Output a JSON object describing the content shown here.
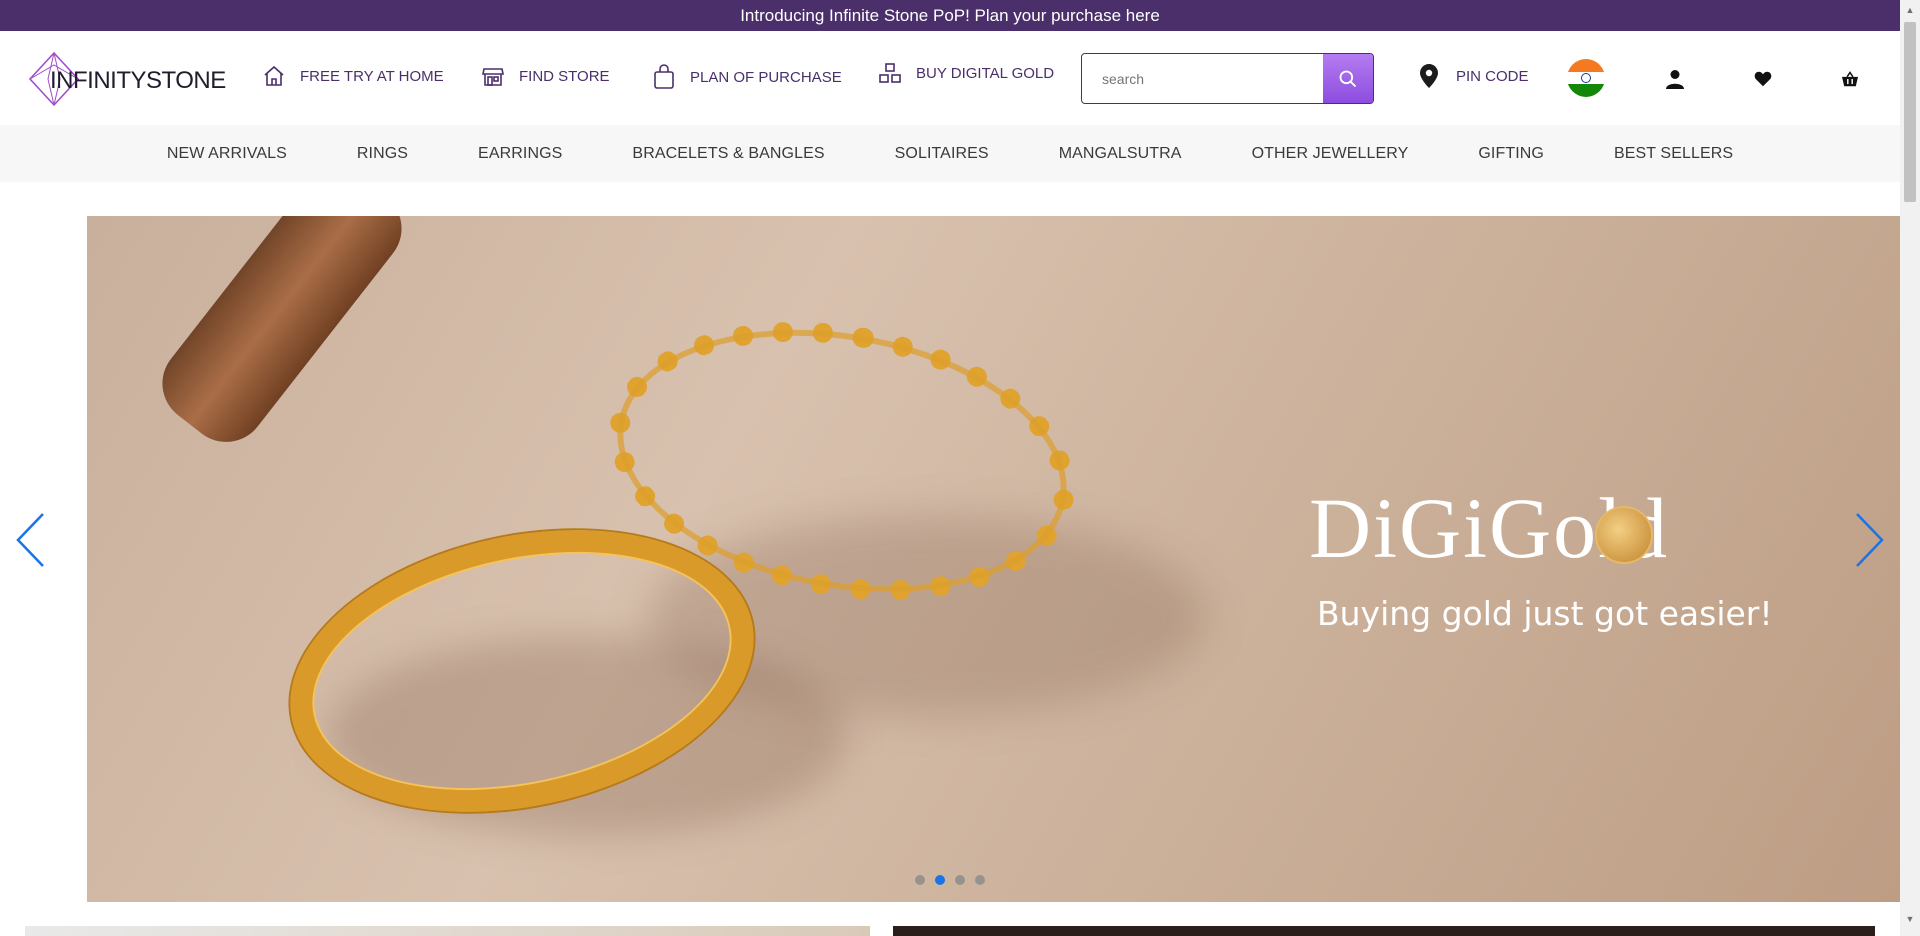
{
  "announcement": {
    "text": "Introducing Infinite Stone PoP! Plan your purchase here"
  },
  "header": {
    "logo_text": "INFINITYSTONE",
    "links": [
      {
        "label": "FREE TRY AT HOME",
        "icon": "home-icon"
      },
      {
        "label": "FIND STORE",
        "icon": "store-icon"
      },
      {
        "label": "PLAN OF PURCHASE",
        "icon": "shopping-bag-icon"
      },
      {
        "label": "BUY DIGITAL GOLD",
        "icon": "gold-bars-icon"
      }
    ],
    "search": {
      "placeholder": "search",
      "value": "search"
    },
    "pin_code": "PIN CODE",
    "country": "India"
  },
  "nav": {
    "items": [
      "NEW ARRIVALS",
      "RINGS",
      "EARRINGS",
      "BRACELETS & BANGLES",
      "SOLITAIRES",
      "MANGALSUTRA",
      "OTHER JEWELLERY",
      "GIFTING",
      "BEST SELLERS"
    ]
  },
  "banner": {
    "title": "DiGiGold",
    "subtitle": "Buying gold just got easier!",
    "slide_count": 4,
    "active_slide": 2
  },
  "colors": {
    "brand": "#4a2f6b",
    "search_button": "#9b5de5",
    "carousel_arrows": "#1a73e8"
  }
}
